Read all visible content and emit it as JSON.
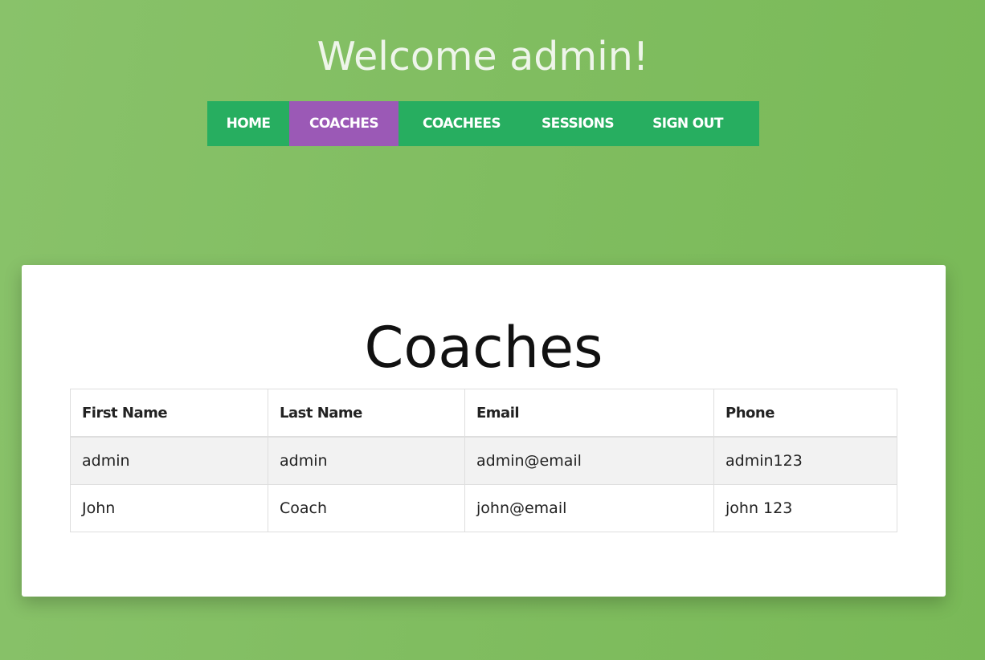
{
  "header": {
    "welcome_text": "Welcome admin!"
  },
  "nav": {
    "items": [
      {
        "label": "HOME",
        "active": false
      },
      {
        "label": "COACHES",
        "active": true
      },
      {
        "label": "COACHEES",
        "active": false
      },
      {
        "label": "SESSIONS",
        "active": false
      },
      {
        "label": "SIGN OUT",
        "active": false
      }
    ]
  },
  "main": {
    "title": "Coaches",
    "table": {
      "headers": [
        "First Name",
        "Last Name",
        "Email",
        "Phone"
      ],
      "rows": [
        [
          "admin",
          "admin",
          "admin@email",
          "admin123"
        ],
        [
          "John",
          "Coach",
          "john@email",
          "john 123"
        ]
      ]
    }
  },
  "colors": {
    "background": "#80bd60",
    "nav_background": "#27ae60",
    "nav_active": "#9b59b6",
    "card_background": "#ffffff"
  }
}
